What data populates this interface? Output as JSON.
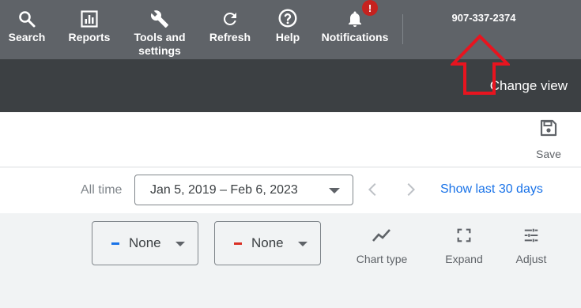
{
  "topnav": {
    "items": [
      {
        "label": "Search",
        "icon": "search-icon"
      },
      {
        "label": "Reports",
        "icon": "reports-icon"
      },
      {
        "label": "Tools and settings",
        "icon": "wrench-icon"
      },
      {
        "label": "Refresh",
        "icon": "refresh-icon"
      },
      {
        "label": "Help",
        "icon": "help-icon"
      },
      {
        "label": "Notifications",
        "icon": "bell-icon",
        "badge": "!"
      }
    ],
    "phone": "907-337-2374"
  },
  "subheader": {
    "change_view": "Change view"
  },
  "toolbar": {
    "save_label": "Save"
  },
  "daterow": {
    "all_time": "All time",
    "date_range": "Jan 5, 2019 – Feb 6, 2023",
    "show_last": "Show last 30 days"
  },
  "chart_controls": {
    "metric1": {
      "label": "None",
      "color": "#1a73e8"
    },
    "metric2": {
      "label": "None",
      "color": "#d93025"
    },
    "chart_type": "Chart type",
    "expand": "Expand",
    "adjust": "Adjust"
  },
  "colors": {
    "topbar": "#5f6368",
    "darkbar": "#3c4043",
    "accent": "#1a73e8",
    "annotation": "#e8141f"
  }
}
